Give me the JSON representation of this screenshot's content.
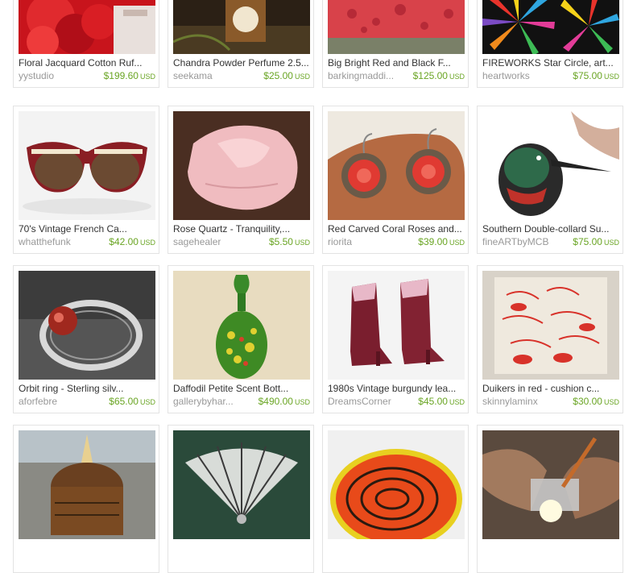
{
  "listings": [
    {
      "title": "Floral Jacquard Cotton Ruf...",
      "shop": "yystudio",
      "price": "$199.60",
      "currency": "USD",
      "icon": "red-ruffle-image"
    },
    {
      "title": "Chandra Powder Perfume 2.5...",
      "shop": "seekama",
      "price": "$25.00",
      "currency": "USD",
      "icon": "perfume-box-image"
    },
    {
      "title": "Big Bright Red and Black F...",
      "shop": "barkingmaddi...",
      "price": "$125.00",
      "currency": "USD",
      "icon": "red-pillow-image"
    },
    {
      "title": "FIREWORKS Star Circle, art...",
      "shop": "heartworks",
      "price": "$75.00",
      "currency": "USD",
      "icon": "fireworks-art-image"
    },
    {
      "title": "70's Vintage French Ca...",
      "shop": "whatthefunk",
      "price": "$42.00",
      "currency": "USD",
      "icon": "sunglasses-image"
    },
    {
      "title": "Rose Quartz - Tranquility,...",
      "shop": "sagehealer",
      "price": "$5.50",
      "currency": "USD",
      "icon": "rose-quartz-image"
    },
    {
      "title": "Red Carved Coral Roses and...",
      "shop": "riorita",
      "price": "$39.00",
      "currency": "USD",
      "icon": "coral-earrings-image"
    },
    {
      "title": "Southern Double-collard Su...",
      "shop": "fineARTbyMCB",
      "price": "$75.00",
      "currency": "USD",
      "icon": "sunbird-print-image"
    },
    {
      "title": "Orbit ring - Sterling silv...",
      "shop": "aforfebre",
      "price": "$65.00",
      "currency": "USD",
      "icon": "orbit-ring-image"
    },
    {
      "title": "Daffodil Petite Scent Bott...",
      "shop": "gallerybyhar...",
      "price": "$490.00",
      "currency": "USD",
      "icon": "scent-bottle-image"
    },
    {
      "title": "1980s Vintage burgundy lea...",
      "shop": "DreamsCorner",
      "price": "$45.00",
      "currency": "USD",
      "icon": "burgundy-boots-image"
    },
    {
      "title": "Duikers in red - cushion c...",
      "shop": "skinnylaminx",
      "price": "$30.00",
      "currency": "USD",
      "icon": "duiker-cushion-image"
    },
    {
      "title": "",
      "shop": "",
      "price": "",
      "currency": "",
      "icon": "wooden-box-image"
    },
    {
      "title": "",
      "shop": "",
      "price": "",
      "currency": "",
      "icon": "fan-brooch-image"
    },
    {
      "title": "",
      "shop": "",
      "price": "",
      "currency": "",
      "icon": "wood-grain-plate-image"
    },
    {
      "title": "",
      "shop": "",
      "price": "",
      "currency": "",
      "icon": "silversmith-hands-image"
    }
  ],
  "colors": {
    "price": "#6aa524",
    "shop": "#999999",
    "title": "#333333",
    "border": "#e3e3e3"
  }
}
